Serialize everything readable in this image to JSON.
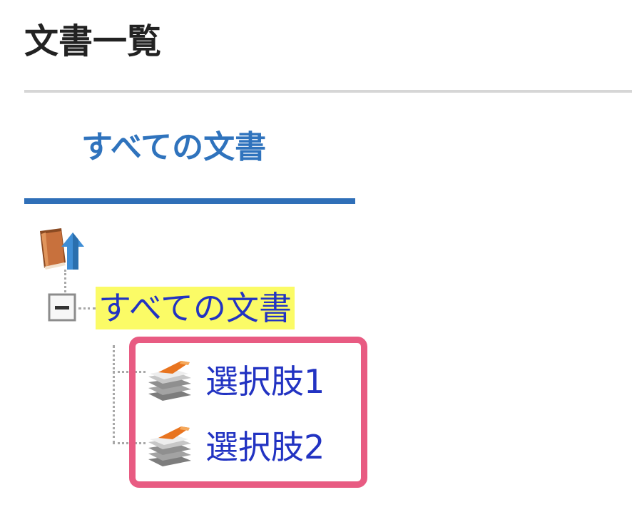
{
  "page": {
    "title": "文書一覧"
  },
  "tabs": [
    {
      "label": "すべての文書",
      "active": true
    }
  ],
  "tree": {
    "root_icon": "book-up-arrow-icon",
    "toggle_icon": "collapse-minus-icon",
    "root_label": "すべての文書",
    "children": [
      {
        "label": "選択肢1",
        "icon": "document-stack-icon"
      },
      {
        "label": "選択肢2",
        "icon": "document-stack-icon"
      }
    ]
  },
  "colors": {
    "title_text": "#222222",
    "tab_text": "#2f73bd",
    "tab_underline": "#2f6fb8",
    "link_text": "#2233c2",
    "root_highlight": "#fbfb66",
    "annotation_border": "#e85b82",
    "rule": "#d6d6d6"
  }
}
